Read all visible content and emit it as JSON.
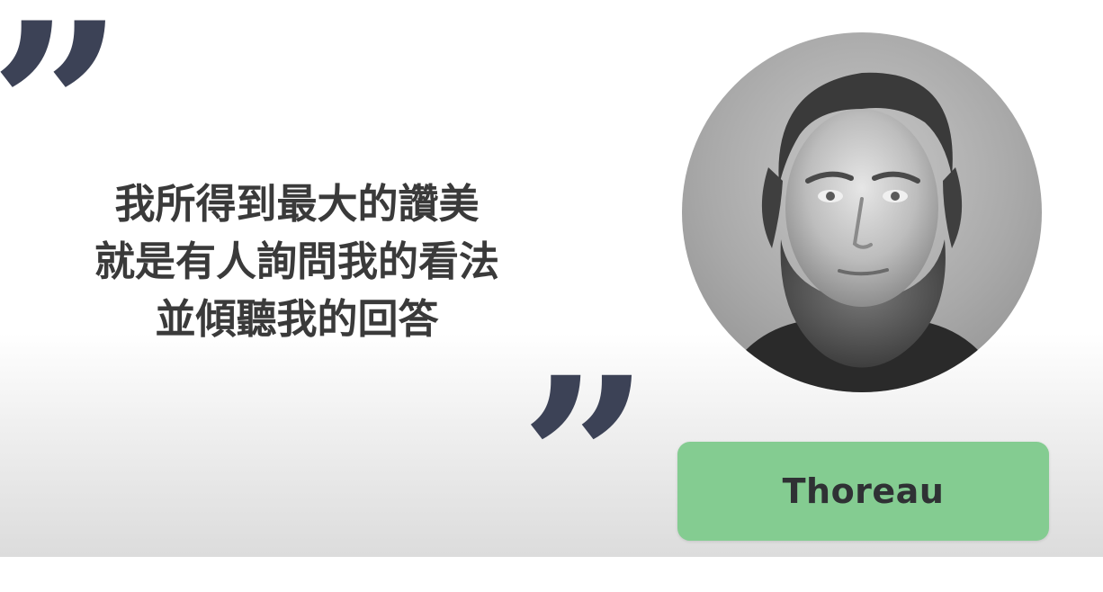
{
  "quote": {
    "open_mark": "”",
    "close_mark": "”",
    "lines": [
      "我所得到最大的讚美",
      "就是有人詢問我的看法",
      "並傾聽我的回答"
    ]
  },
  "portrait": {
    "subject": "Thoreau"
  },
  "name_badge": {
    "label": "Thoreau"
  },
  "colors": {
    "quote_mark": "#3c4256",
    "quote_text": "#3a3a3a",
    "badge_background": "#84cc91",
    "badge_text": "#2f3134"
  }
}
